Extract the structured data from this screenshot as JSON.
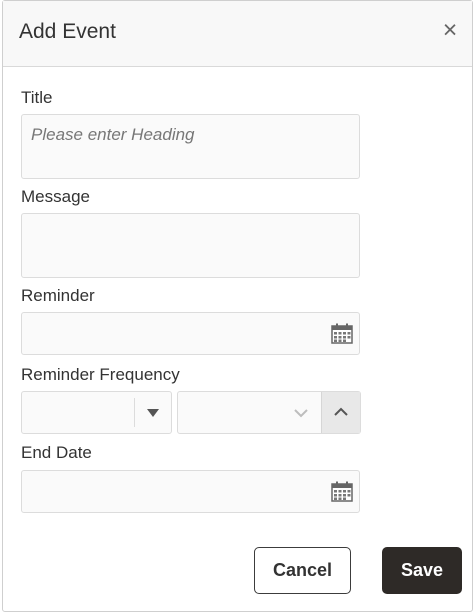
{
  "dialog": {
    "title": "Add Event",
    "close_glyph": "×"
  },
  "form": {
    "title_label": "Title",
    "title_placeholder": "Please enter Heading",
    "message_label": "Message",
    "reminder_label": "Reminder",
    "reminder_frequency_label": "Reminder Frequency",
    "end_date_label": "End Date"
  },
  "buttons": {
    "cancel_label": "Cancel",
    "save_label": "Save"
  },
  "icons": {
    "close": "close-icon",
    "calendar": "calendar-icon",
    "dropdown": "caret-down-icon",
    "spin_down": "chevron-down-icon",
    "spin_up": "chevron-up-icon"
  },
  "colors": {
    "save_button_bg": "#2e2a27",
    "header_bg": "#f8f8f8",
    "field_bg": "#fafafa"
  }
}
